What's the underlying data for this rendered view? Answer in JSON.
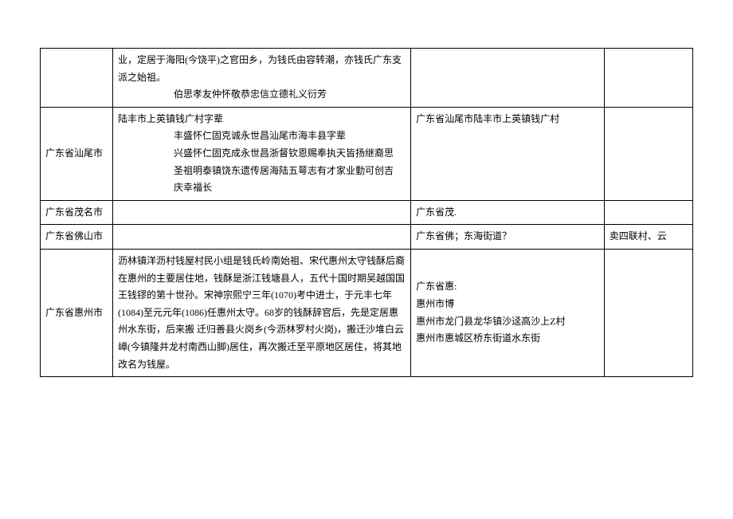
{
  "rows": [
    {
      "col1": "",
      "col2_line1": "业，定居于海阳(今饶平)之官田乡，为钱氏由容转潮，亦钱氏广东支派之始祖。",
      "col2_line2": "伯思孝友仲怀敬恭忠信立德礼义衍芳",
      "col3": "",
      "col4": ""
    },
    {
      "col1": "广东省汕尾市",
      "col2_line1": "陆丰市上英镇钱广村字辈",
      "col2_line2": "丰盛怀仁固克诚永世昌汕尾市海丰县字辈",
      "col2_line3": "兴盛怀仁固克成永世昌浙督钦恩赐奉执天皆扬继裔思",
      "col2_line4": "圣祖明泰镇饶东遗传居海陆五萼志有才家业勤可创吉",
      "col2_line5": "庆幸福长",
      "col3": "广东省汕尾市陆丰市上英镇钱广村",
      "col4": ""
    },
    {
      "col1": "广东省茂名市",
      "col2": "",
      "col3": "广东省茂.",
      "col4": ""
    },
    {
      "col1": "广东省佛山市",
      "col2": "",
      "col3": "广东省佛；东海街道？",
      "col4": "卖四联村、云"
    },
    {
      "col1": "广东省惠州市",
      "col2_line1": "沥林镇洋沥村钱屋村民小组是钱氏岭南始祖、宋代惠州太守钱酥后裔在惠州的主要居住地，钱酥是浙江钱塘县人，五代十国时期吴越国国王钱镠的第十世孙。宋神宗熙宁三年(1070)考中进士，于元丰七年(1084)至元元年(1086)任惠州太守。68岁的钱酥辞官后，先是定居惠州水东街，后来搬",
      "col2_line2": "迁归善县火岗乡(今沥林罗村火岗)，搬迁沙堆白云嶂(今镇隆井龙村南西山脚)居住，再次搬迁至平原地区居住，将其地改名为钱屋。",
      "col3_line1": "广东省惠:",
      "col3_line2": "惠州市博",
      "col3_line3": "惠州市龙门县龙华镇沙迳高沙上Z村",
      "col3_line4": "惠州市惠城区桥东街道水东街",
      "col4": ""
    }
  ]
}
